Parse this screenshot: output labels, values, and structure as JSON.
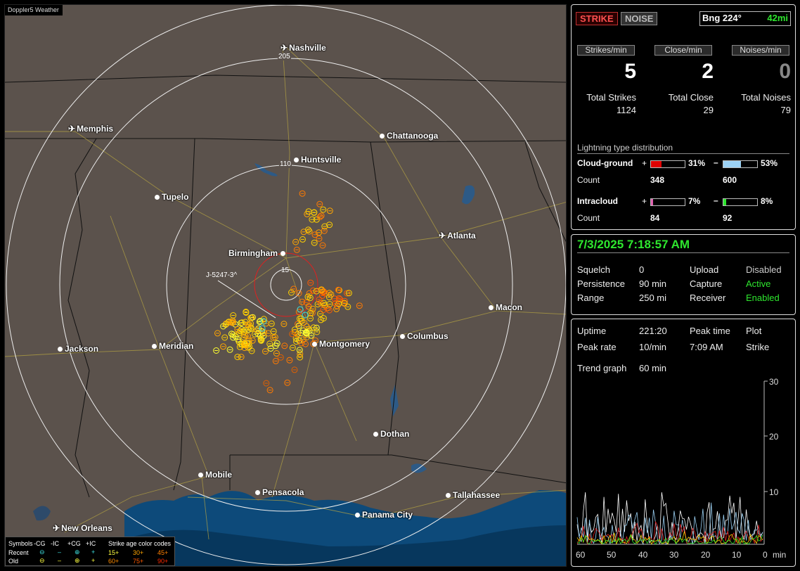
{
  "app": {
    "title": "Doppler5 Weather"
  },
  "map": {
    "cities": [
      {
        "name": "Nashville",
        "icon": "plane"
      },
      {
        "name": "Memphis",
        "icon": "plane"
      },
      {
        "name": "Chattanooga",
        "icon": "dot"
      },
      {
        "name": "Huntsville",
        "icon": "dot"
      },
      {
        "name": "Tupelo",
        "icon": "dot"
      },
      {
        "name": "Atlanta",
        "icon": "plane"
      },
      {
        "name": "Birmingham",
        "icon": "dot"
      },
      {
        "name": "Macon",
        "icon": "dot"
      },
      {
        "name": "Jackson",
        "icon": "dot"
      },
      {
        "name": "Meridian",
        "icon": "dot"
      },
      {
        "name": "Montgomery",
        "icon": "dot"
      },
      {
        "name": "Columbus",
        "icon": "dot"
      },
      {
        "name": "Dothan",
        "icon": "dot"
      },
      {
        "name": "Mobile",
        "icon": "dot"
      },
      {
        "name": "Pensacola",
        "icon": "dot"
      },
      {
        "name": "Tallahassee",
        "icon": "dot"
      },
      {
        "name": "Panama City",
        "icon": "dot"
      },
      {
        "name": "New Orleans",
        "icon": "plane"
      }
    ],
    "range_rings": [
      "205",
      "110",
      "15"
    ],
    "marker_label": "J-5247-3^",
    "legend": {
      "symbols_title": "Symbols",
      "col_cg_neg": "-CG",
      "col_ic_neg": "-IC",
      "col_cg_pos": "+CG",
      "col_ic_pos": "+IC",
      "age_title": "Strike age color codes",
      "row_recent": "Recent",
      "row_old": "Old",
      "recent_ages": [
        "15+",
        "30+",
        "45+"
      ],
      "old_ages": [
        "60+",
        "75+",
        "90+"
      ],
      "age_colors": [
        "#ffff40",
        "#ffa500",
        "#ff7f00",
        "#ff8c00",
        "#ff5a00",
        "#ff2a00"
      ]
    }
  },
  "panel": {
    "mode_buttons": {
      "strike": "STRIKE",
      "noise": "NOISE"
    },
    "bearing": {
      "label": "Bng 224°",
      "distance": "42mi"
    },
    "rates": [
      {
        "header": "Strikes/min",
        "value": "5"
      },
      {
        "header": "Close/min",
        "value": "2"
      },
      {
        "header": "Noises/min",
        "value": "0"
      }
    ],
    "totals": [
      {
        "label": "Total Strikes",
        "value": "1124"
      },
      {
        "label": "Total Close",
        "value": "29"
      },
      {
        "label": "Total Noises",
        "value": "79"
      }
    ],
    "distribution": {
      "title": "Lightning type distribution",
      "cg_label": "Cloud-ground",
      "ic_label": "Intracloud",
      "plus": "+",
      "minus": "–",
      "count_label": "Count",
      "cg_pos": {
        "pct": "31%",
        "fraction": 0.31,
        "count": "348",
        "color": "#e00000"
      },
      "cg_neg": {
        "pct": "53%",
        "fraction": 0.53,
        "count": "600",
        "color": "#9cd2f5"
      },
      "ic_pos": {
        "pct": "7%",
        "fraction": 0.07,
        "count": "84",
        "color": "#e060b0"
      },
      "ic_neg": {
        "pct": "8%",
        "fraction": 0.08,
        "count": "92",
        "color": "#2ee62e"
      }
    }
  },
  "status": {
    "datetime": "7/3/2025 7:18:57 AM",
    "rows": [
      {
        "label": "Squelch",
        "value": "0",
        "label2": "Upload",
        "value2": "Disabled",
        "color2": "#cccccc"
      },
      {
        "label": "Persistence",
        "value": "90 min",
        "label2": "Capture",
        "value2": "Active",
        "color2": "#2ee62e"
      },
      {
        "label": "Range",
        "value": "250 mi",
        "label2": "Receiver",
        "value2": "Enabled",
        "color2": "#2ee62e"
      }
    ]
  },
  "stats": {
    "uptime_label": "Uptime",
    "uptime_value": "221:20",
    "peak_time_label": "Peak time",
    "plot_label": "Plot",
    "peak_rate_label": "Peak rate",
    "peak_rate_value": "10/min",
    "peak_time_value": "7:09 AM",
    "plot_value": "Strike",
    "trend_label": "Trend graph",
    "trend_value": "60 min",
    "y_ticks": [
      "30",
      "20",
      "10"
    ],
    "x_ticks": [
      "60",
      "50",
      "40",
      "30",
      "20",
      "10",
      "0"
    ],
    "x_unit": "min"
  }
}
